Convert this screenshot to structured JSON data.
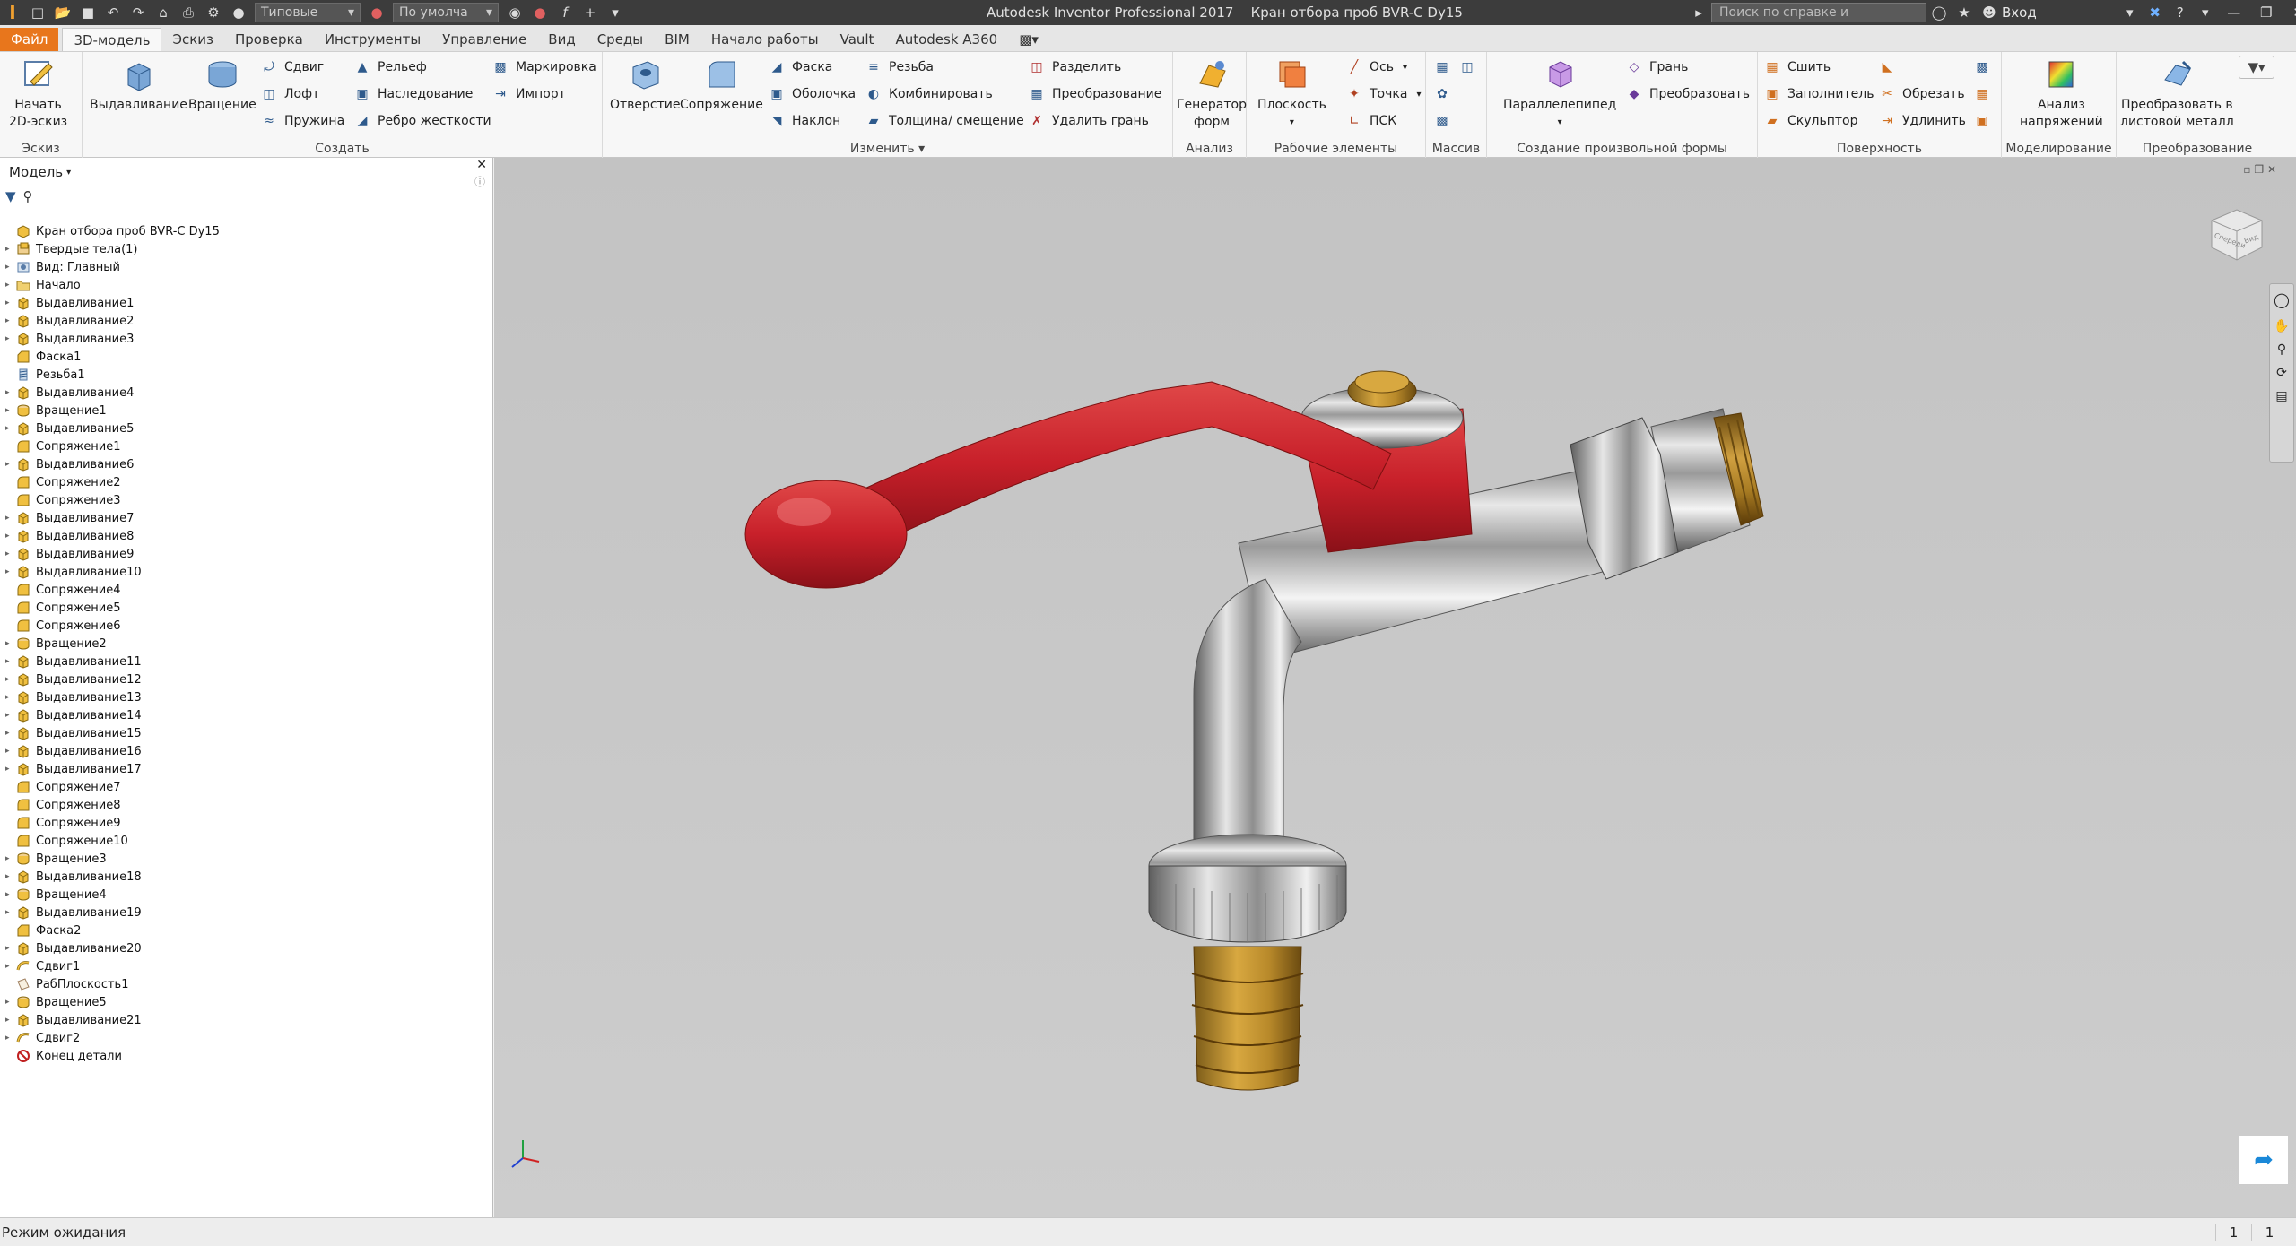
{
  "app": {
    "title": "Autodesk Inventor Professional 2017",
    "document": "Кран отбора проб BVR-C Dy15"
  },
  "quick_access": {
    "appearance_combo": "Типовые",
    "material_combo": "По умолча"
  },
  "search": {
    "placeholder": "Поиск по справке и командам"
  },
  "signin": "Вход",
  "menu_tabs": [
    "Файл",
    "3D-модель",
    "Эскиз",
    "Проверка",
    "Инструменты",
    "Управление",
    "Вид",
    "Среды",
    "BIM",
    "Начало работы",
    "Vault",
    "Autodesk A360"
  ],
  "ribbon": {
    "sketch": {
      "start_line1": "Начать",
      "start_line2": "2D-эскиз",
      "title": "Эскиз"
    },
    "create": {
      "extrude": "Выдавливание",
      "revolve": "Вращение",
      "sweep": "Сдвиг",
      "loft": "Лофт",
      "coil": "Пружина",
      "emboss": "Рельеф",
      "derive": "Наследование",
      "rib": "Ребро жесткости",
      "decal": "Маркировка",
      "import": "Импорт",
      "title": "Создать"
    },
    "modify": {
      "hole": "Отверстие",
      "fillet": "Сопряжение",
      "chamfer": "Фаска",
      "shell": "Оболочка",
      "draft": "Наклон",
      "thread": "Резьба",
      "combine": "Комбинировать",
      "thicken": "Толщина/ смещение",
      "split": "Разделить",
      "direct": "Преобразование",
      "delete_face": "Удалить грань",
      "title": "Изменить"
    },
    "explore": {
      "shape_gen_line1": "Генератор",
      "shape_gen_line2": "форм",
      "title": "Анализ"
    },
    "work_features": {
      "plane": "Плоскость",
      "axis": "Ось",
      "point": "Точка",
      "ucs": "ПСК",
      "title": "Рабочие элементы"
    },
    "pattern": {
      "title": "Массив"
    },
    "freeform": {
      "box": "Параллелепипед",
      "face": "Грань",
      "convert": "Преобразовать",
      "title": "Создание произвольной формы"
    },
    "surface": {
      "stitch": "Сшить",
      "patch": "Заполнитель",
      "sculpt": "Скульптор",
      "trim": "Обрезать",
      "extend": "Удлинить",
      "title": "Поверхность"
    },
    "simulation": {
      "stress_line1": "Анализ",
      "stress_line2": "напряжений",
      "title": "Моделирование"
    },
    "convert": {
      "sheet_line1": "Преобразовать в",
      "sheet_line2": "листовой металл",
      "title": "Преобразование"
    }
  },
  "browser": {
    "title": "Модель",
    "root": "Кран отбора проб BVR-C Dy15",
    "items": [
      {
        "label": "Твердые тела(1)",
        "icon": "solid-bodies",
        "exp": true
      },
      {
        "label": "Вид: Главный",
        "icon": "view",
        "exp": true
      },
      {
        "label": "Начало",
        "icon": "folder",
        "exp": true
      },
      {
        "label": "Выдавливание1",
        "icon": "extrude",
        "exp": true
      },
      {
        "label": "Выдавливание2",
        "icon": "extrude",
        "exp": true
      },
      {
        "label": "Выдавливание3",
        "icon": "extrude",
        "exp": true
      },
      {
        "label": "Фаска1",
        "icon": "chamfer",
        "exp": false
      },
      {
        "label": "Резьба1",
        "icon": "thread",
        "exp": false
      },
      {
        "label": "Выдавливание4",
        "icon": "extrude",
        "exp": true
      },
      {
        "label": "Вращение1",
        "icon": "revolve",
        "exp": true
      },
      {
        "label": "Выдавливание5",
        "icon": "extrude",
        "exp": true
      },
      {
        "label": "Сопряжение1",
        "icon": "fillet",
        "exp": false
      },
      {
        "label": "Выдавливание6",
        "icon": "extrude",
        "exp": true
      },
      {
        "label": "Сопряжение2",
        "icon": "fillet",
        "exp": false
      },
      {
        "label": "Сопряжение3",
        "icon": "fillet",
        "exp": false
      },
      {
        "label": "Выдавливание7",
        "icon": "extrude",
        "exp": true
      },
      {
        "label": "Выдавливание8",
        "icon": "extrude",
        "exp": true
      },
      {
        "label": "Выдавливание9",
        "icon": "extrude",
        "exp": true
      },
      {
        "label": "Выдавливание10",
        "icon": "extrude",
        "exp": true
      },
      {
        "label": "Сопряжение4",
        "icon": "fillet",
        "exp": false
      },
      {
        "label": "Сопряжение5",
        "icon": "fillet",
        "exp": false
      },
      {
        "label": "Сопряжение6",
        "icon": "fillet",
        "exp": false
      },
      {
        "label": "Вращение2",
        "icon": "revolve",
        "exp": true
      },
      {
        "label": "Выдавливание11",
        "icon": "extrude",
        "exp": true
      },
      {
        "label": "Выдавливание12",
        "icon": "extrude",
        "exp": true
      },
      {
        "label": "Выдавливание13",
        "icon": "extrude",
        "exp": true
      },
      {
        "label": "Выдавливание14",
        "icon": "extrude",
        "exp": true
      },
      {
        "label": "Выдавливание15",
        "icon": "extrude",
        "exp": true
      },
      {
        "label": "Выдавливание16",
        "icon": "extrude",
        "exp": true
      },
      {
        "label": "Выдавливание17",
        "icon": "extrude",
        "exp": true
      },
      {
        "label": "Сопряжение7",
        "icon": "fillet",
        "exp": false
      },
      {
        "label": "Сопряжение8",
        "icon": "fillet",
        "exp": false
      },
      {
        "label": "Сопряжение9",
        "icon": "fillet",
        "exp": false
      },
      {
        "label": "Сопряжение10",
        "icon": "fillet",
        "exp": false
      },
      {
        "label": "Вращение3",
        "icon": "revolve",
        "exp": true
      },
      {
        "label": "Выдавливание18",
        "icon": "extrude",
        "exp": true
      },
      {
        "label": "Вращение4",
        "icon": "revolve",
        "exp": true
      },
      {
        "label": "Выдавливание19",
        "icon": "extrude",
        "exp": true
      },
      {
        "label": "Фаска2",
        "icon": "chamfer",
        "exp": false
      },
      {
        "label": "Выдавливание20",
        "icon": "extrude",
        "exp": true
      },
      {
        "label": "Сдвиг1",
        "icon": "sweep",
        "exp": true
      },
      {
        "label": "РабПлоскость1",
        "icon": "workplane",
        "exp": false
      },
      {
        "label": "Вращение5",
        "icon": "revolve",
        "exp": true
      },
      {
        "label": "Выдавливание21",
        "icon": "extrude",
        "exp": true
      },
      {
        "label": "Сдвиг2",
        "icon": "sweep",
        "exp": true
      },
      {
        "label": "Конец детали",
        "icon": "end-of-part",
        "exp": false
      }
    ]
  },
  "viewcube": {
    "front": "Спереди",
    "right": "Вид"
  },
  "status": {
    "text": "Режим ожидания",
    "count1": "1",
    "count2": "1"
  },
  "colors": {
    "file_tab": "#e8761c",
    "handle_red": "#c8202a",
    "brass": "#b8892a",
    "viewport_bg": "#c6c6c6"
  }
}
